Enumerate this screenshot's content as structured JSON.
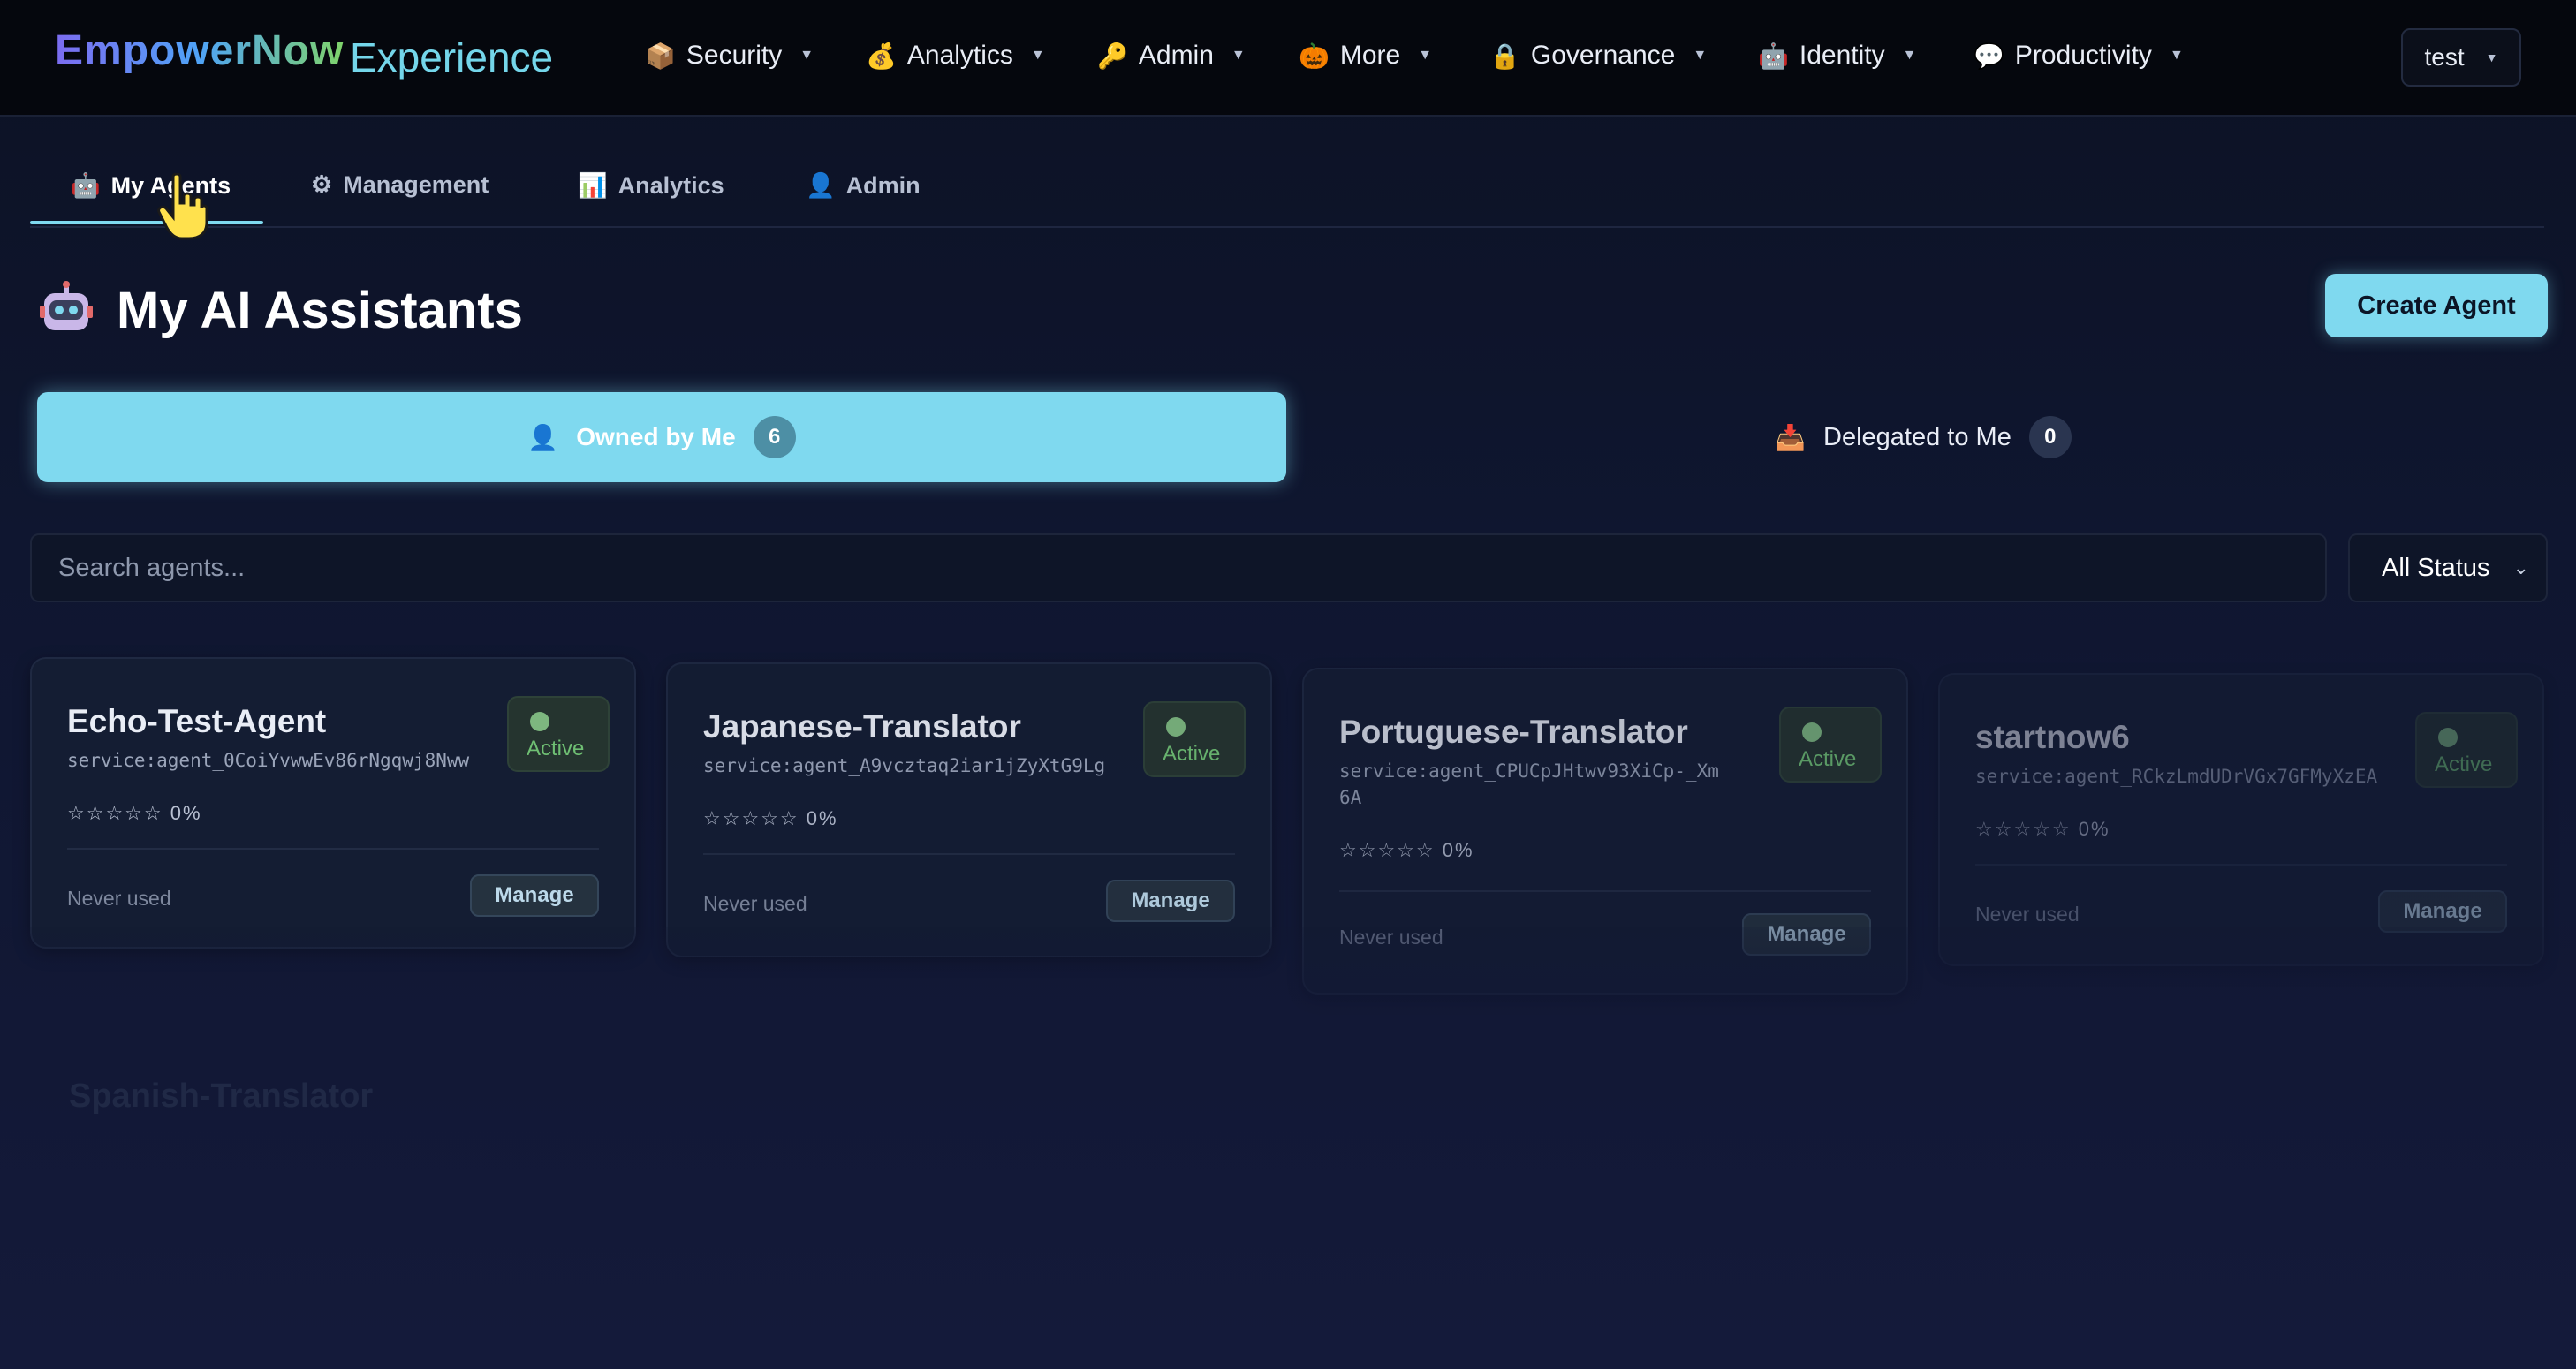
{
  "brand": {
    "name": "EmpowerNow",
    "suffix": "Experience"
  },
  "nav": [
    {
      "icon": "📦",
      "label": "Security"
    },
    {
      "icon": "💰",
      "label": "Analytics"
    },
    {
      "icon": "🔑",
      "label": "Admin"
    },
    {
      "icon": "🎃",
      "label": "More"
    },
    {
      "icon": "🔒",
      "label": "Governance"
    },
    {
      "icon": "🤖",
      "label": "Identity"
    },
    {
      "icon": "💬",
      "label": "Productivity"
    }
  ],
  "user": {
    "label": "test"
  },
  "subtabs": [
    {
      "icon": "🤖",
      "label": "My Agents"
    },
    {
      "icon": "⚙",
      "label": "Management"
    },
    {
      "icon": "📊",
      "label": "Analytics"
    },
    {
      "icon": "👤",
      "label": "Admin"
    }
  ],
  "page": {
    "title": "My AI Assistants",
    "create_label": "Create Agent"
  },
  "ownership_tabs": {
    "owned": {
      "label": "Owned by Me",
      "count": "6"
    },
    "delegated": {
      "label": "Delegated to Me",
      "count": "0"
    }
  },
  "search": {
    "placeholder": "Search agents..."
  },
  "status_filter": {
    "selected": "All Status"
  },
  "agents": [
    {
      "name": "Echo-Test-Agent",
      "service": "service:agent_0CoiYvwwEv86rNgqwj8Nww",
      "status": "Active",
      "rating": 0,
      "rating_text": "0%",
      "usage": "Never used",
      "manage_label": "Manage"
    },
    {
      "name": "Japanese-Translator",
      "service": "service:agent_A9vcztaq2iar1jZyXtG9Lg",
      "status": "Active",
      "rating": 0,
      "rating_text": "0%",
      "usage": "Never used",
      "manage_label": "Manage"
    },
    {
      "name": "Portuguese-Translator",
      "service": "service:agent_CPUCpJHtwv93XiCp-_Xm6A",
      "status": "Active",
      "rating": 0,
      "rating_text": "0%",
      "usage": "Never used",
      "manage_label": "Manage"
    },
    {
      "name": "startnow6",
      "service": "service:agent_RCkzLmdUDrVGx7GFMyXzEA",
      "status": "Active",
      "rating": 0,
      "rating_text": "0%",
      "usage": "Never used",
      "manage_label": "Manage"
    }
  ],
  "ghost": {
    "name": "Spanish-Translator"
  },
  "colors": {
    "accent": "#7fd9ef",
    "nav_bg": "#05070d",
    "page_bg": "#0f1630",
    "active_green": "#6fbf73"
  }
}
